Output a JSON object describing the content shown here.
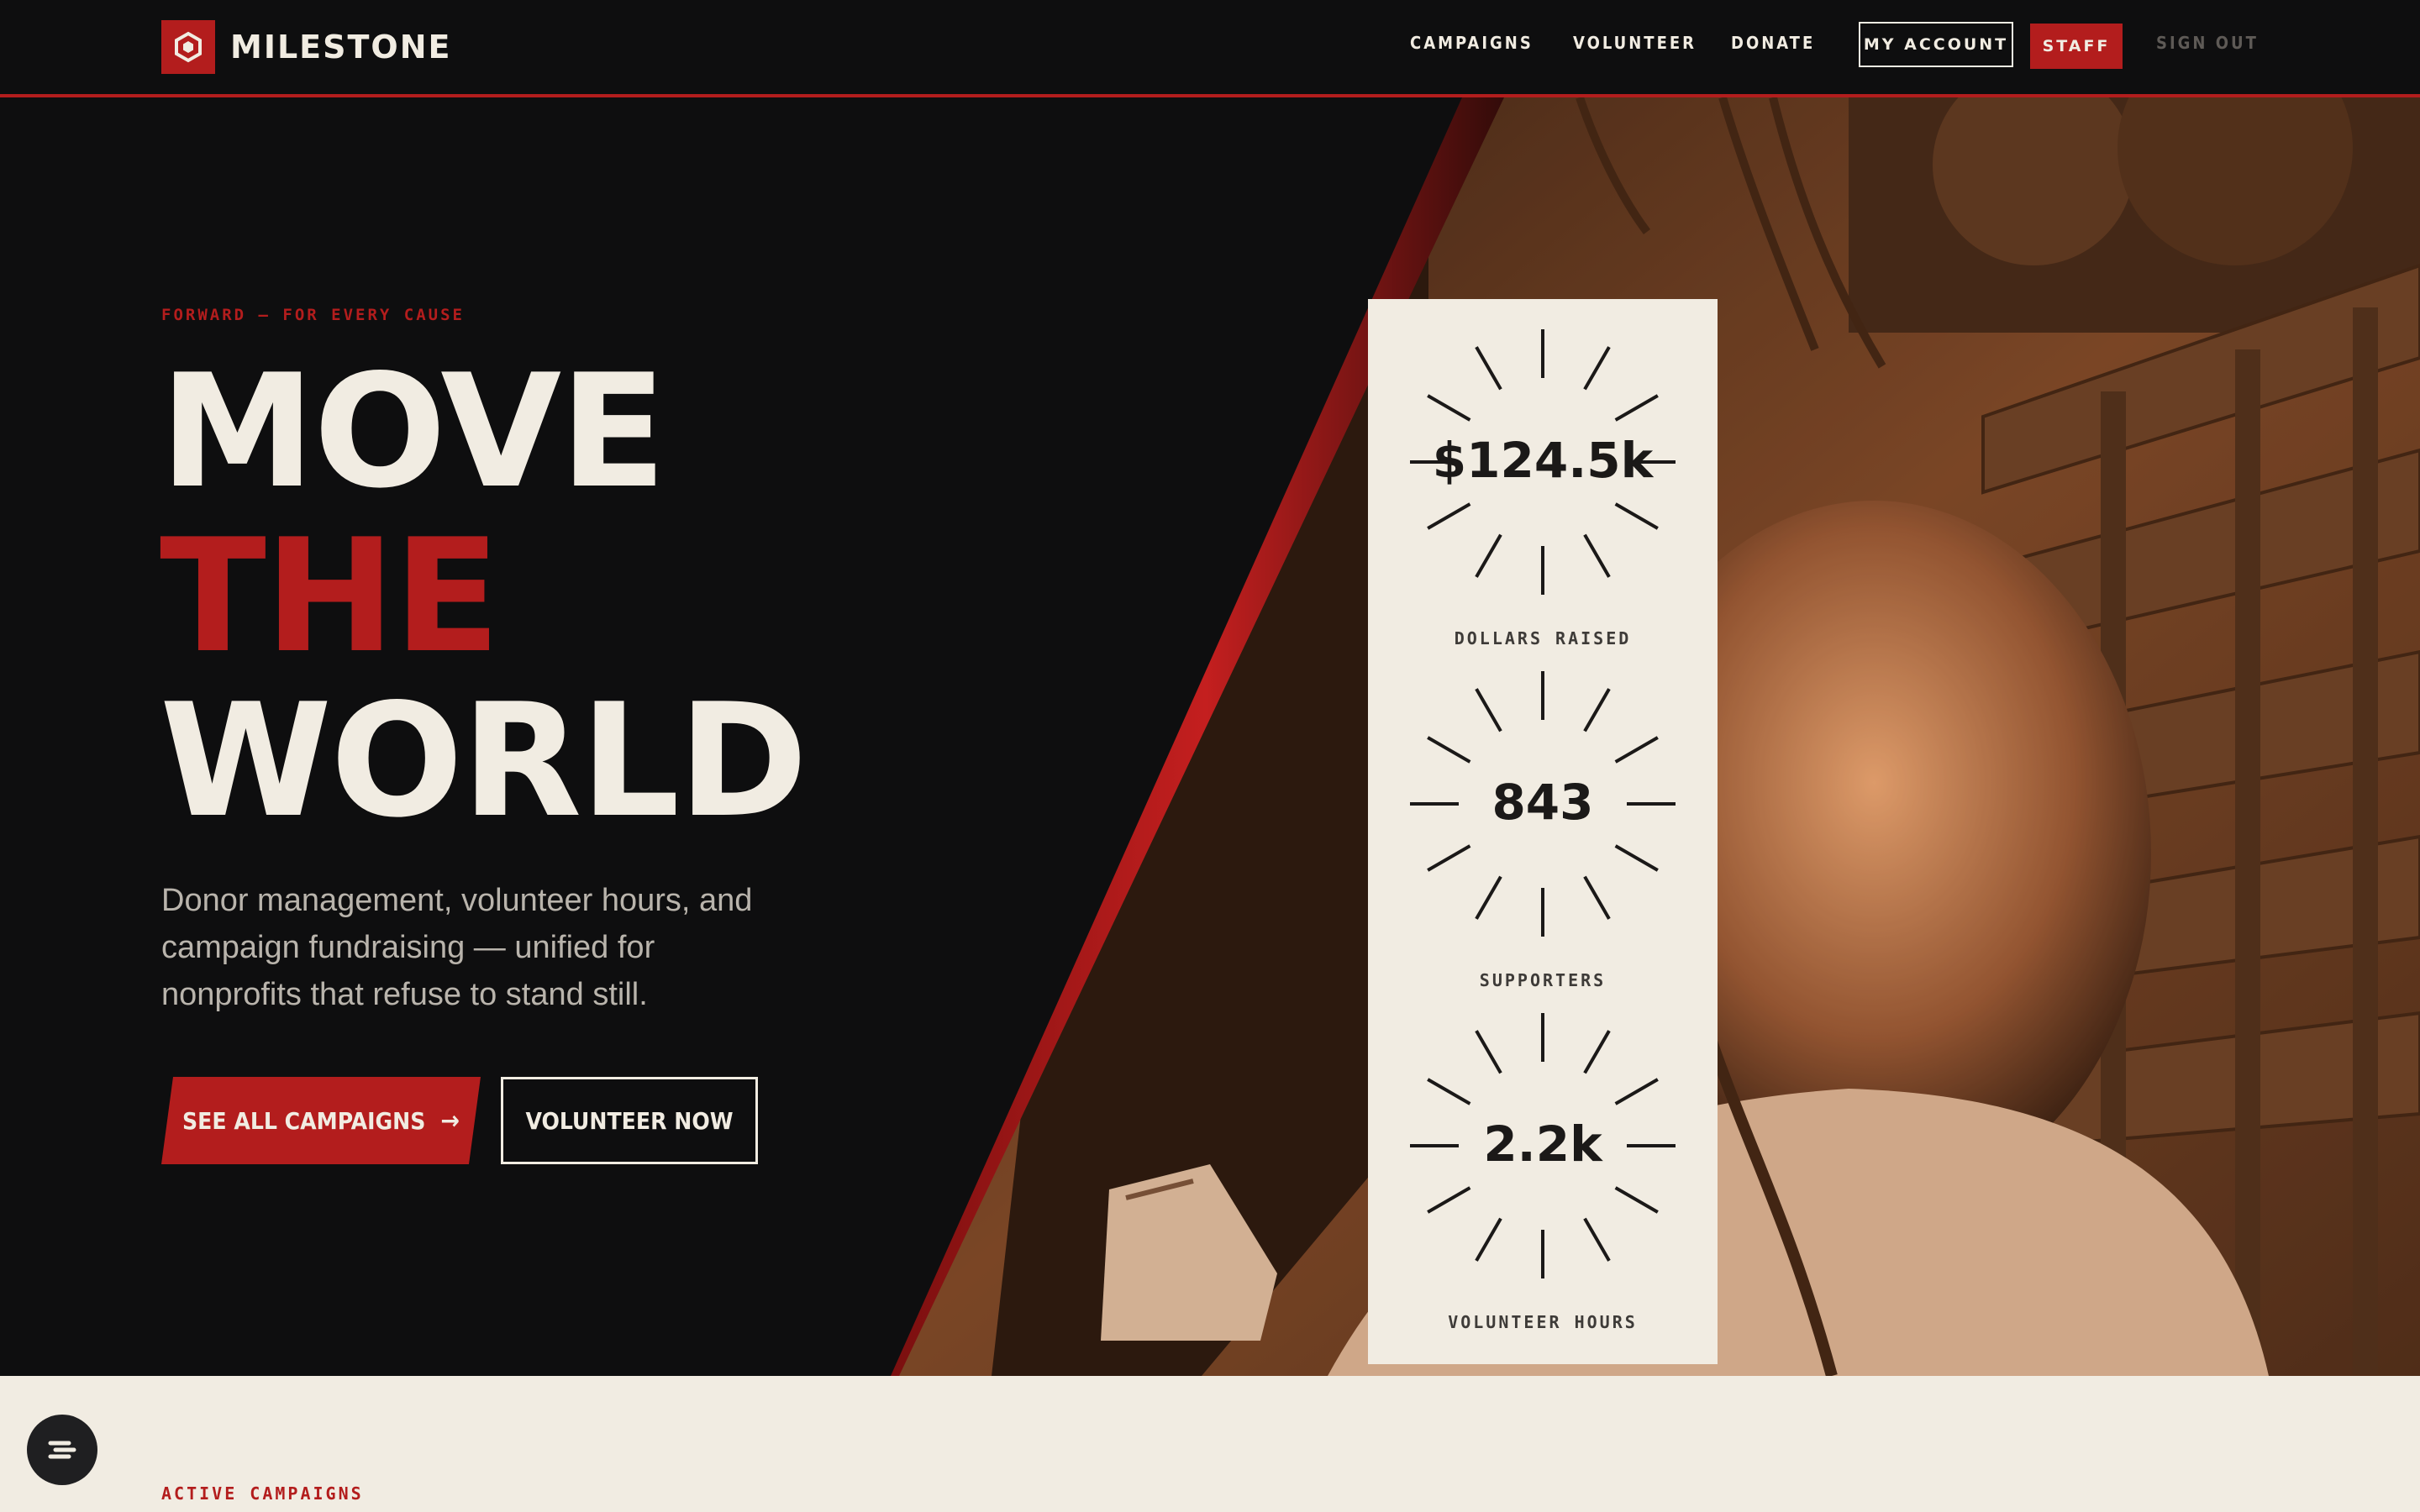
{
  "brand": {
    "name": "MILESTONE"
  },
  "nav": {
    "links": [
      "CAMPAIGNS",
      "VOLUNTEER",
      "DONATE"
    ],
    "account_label": "MY ACCOUNT",
    "staff_label": "STAFF",
    "signout_label": "SIGN OUT"
  },
  "hero": {
    "eyebrow": "FORWARD — FOR EVERY CAUSE",
    "headline": [
      "MOVE",
      "THE",
      "WORLD"
    ],
    "lede": "Donor management, volunteer hours, and campaign fundraising — unified for nonprofits that refuse to stand still.",
    "primary_cta": "SEE ALL CAMPAIGNS",
    "primary_cta_icon": "arrow-right-icon",
    "secondary_cta": "VOLUNTEER NOW"
  },
  "stats": [
    {
      "value": "$124.5k",
      "label": "DOLLARS RAISED"
    },
    {
      "value": "843",
      "label": "SUPPORTERS"
    },
    {
      "value": "2.2k",
      "label": "VOLUNTEER HOURS"
    }
  ],
  "section2": {
    "eyebrow": "ACTIVE CAMPAIGNS"
  },
  "help": {
    "icon": "chat-support-icon"
  },
  "colors": {
    "accent": "#b31d1d",
    "dark": "#0e0e0f",
    "cream": "#f1ece2",
    "photo_tint": "#d08a55"
  }
}
